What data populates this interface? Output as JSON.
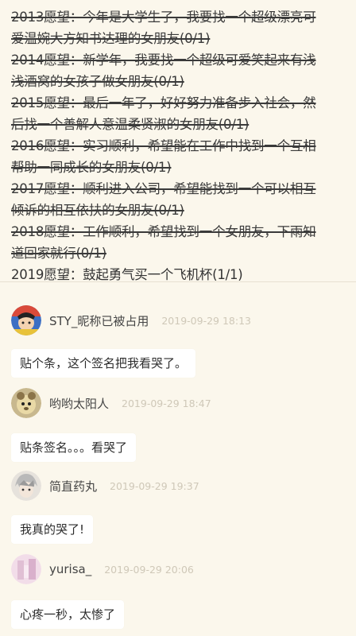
{
  "wishes": [
    {
      "line1": "2013愿望：今年是大学生了，我要找一个超级漂亮可",
      "line2": "爱温婉大方知书达理的女朋友(0/1)",
      "struck": true
    },
    {
      "line1": "2014愿望：新学年，我要找一个超级可爱笑起来有浅",
      "line2": "浅酒窝的女孩子做女朋友(0/1)",
      "struck": true
    },
    {
      "line1": "2015愿望：最后一年了，好好努力准备步入社会，然",
      "line2": "后找一个善解人意温柔贤淑的女朋友(0/1)",
      "struck": true
    },
    {
      "line1": "2016愿望：实习顺利，希望能在工作中找到一个互相",
      "line2": "帮助一同成长的女朋友(0/1)",
      "struck": true
    },
    {
      "line1": "2017愿望：顺利进入公司，希望能找到一个可以相互",
      "line2": "倾诉的相互依扶的女朋友(0/1)",
      "struck": true
    },
    {
      "line1": "2018愿望：工作顺利，希望找到一个女朋友，下雨知",
      "line2": "道回家就行(0/1)",
      "struck": true
    },
    {
      "line1": "2019愿望：鼓起勇气买一个飞机杯(1/1)",
      "line2": "",
      "struck": false
    }
  ],
  "comments": [
    {
      "username": "STY_昵称已被占用",
      "timestamp": "2019-09-29 18:13",
      "text": "贴个条，这个签名把我看哭了。"
    },
    {
      "username": "哟哟太阳人",
      "timestamp": "2019-09-29 18:47",
      "text": "贴条签名。。。看哭了"
    },
    {
      "username": "简直药丸",
      "timestamp": "2019-09-29 19:37",
      "text": "我真的哭了!"
    },
    {
      "username": "yurisa_",
      "timestamp": "2019-09-29 20:06",
      "text": "心疼一秒，太惨了"
    }
  ]
}
